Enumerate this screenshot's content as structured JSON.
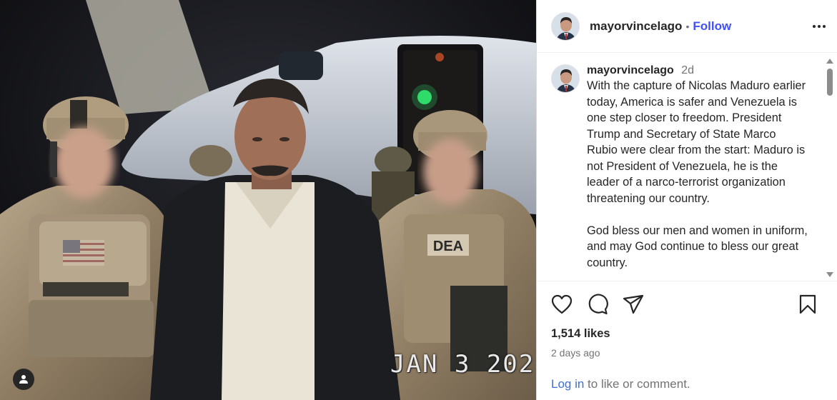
{
  "post": {
    "username": "mayorvincelago",
    "follow_label": "Follow",
    "header_separator": "•",
    "media": {
      "date_stamp": "JAN  3 202",
      "patch_text": "DEA"
    },
    "caption": {
      "username": "mayorvincelago",
      "time": "2d",
      "text": "With the capture of Nicolas Maduro earlier today, America is safer and Venezuela is one step closer to freedom. President Trump and Secretary of State Marco Rubio were clear from the start: Maduro is not President of Venezuela, he is the leader of a narco-terrorist organization threatening our country.\n\nGod bless our men and women in uniform, and may God continue to bless our great country."
    },
    "likes": "1,514 likes",
    "date": "2 days ago",
    "login_link": "Log in",
    "login_suffix": " to like or comment.",
    "icons": [
      "heart-icon",
      "comment-icon",
      "share-icon",
      "bookmark-icon",
      "more-options-icon",
      "tagged-user-icon"
    ]
  }
}
